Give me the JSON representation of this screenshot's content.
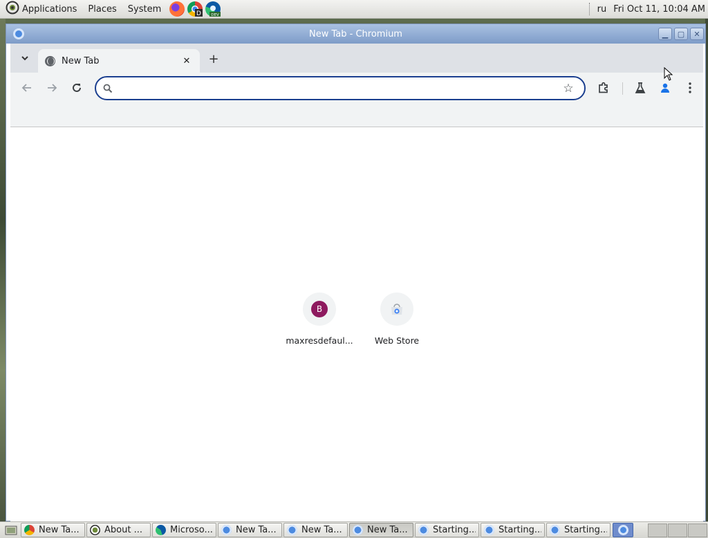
{
  "top_panel": {
    "menus": [
      "Applications",
      "Places",
      "System"
    ],
    "launchers": [
      "firefox-icon",
      "chrome-icon",
      "edge-dev-icon"
    ],
    "language": "ru",
    "clock": "Fri Oct 11, 10:04 AM"
  },
  "window": {
    "title": "New Tab - Chromium",
    "buttons": [
      "minimize",
      "maximize",
      "close"
    ]
  },
  "browser": {
    "tab": {
      "title": "New Tab",
      "close_symbol": "✕"
    },
    "new_tab_symbol": "+",
    "omnibox": {
      "value": "",
      "placeholder": ""
    }
  },
  "new_tab_page": {
    "shortcuts": [
      {
        "title": "maxresdefaul...",
        "letter": "B"
      },
      {
        "title": "Web Store",
        "letter": ""
      }
    ]
  },
  "taskbar": {
    "tasks": [
      {
        "label": "New Ta...",
        "icon": "chrome-icon",
        "active": false
      },
      {
        "label": "About ...",
        "icon": "gnome-about-icon",
        "active": false
      },
      {
        "label": "Microso...",
        "icon": "edge-icon",
        "active": false
      },
      {
        "label": "New Ta...",
        "icon": "chromium-icon",
        "active": false
      },
      {
        "label": "New Ta...",
        "icon": "chromium-icon",
        "active": false
      },
      {
        "label": "New Ta...",
        "icon": "chromium-icon",
        "active": true
      },
      {
        "label": "Starting...",
        "icon": "chromium-icon",
        "active": false
      },
      {
        "label": "Starting...",
        "icon": "chromium-icon",
        "active": false
      },
      {
        "label": "Starting...",
        "icon": "chromium-icon",
        "active": false
      }
    ]
  },
  "colors": {
    "omnibox_border": "#1a3e8f",
    "titlebar": "#8aa6d0",
    "shortcut_letter_bg": "#8e1a5f",
    "profile_icon": "#1a73e8"
  }
}
